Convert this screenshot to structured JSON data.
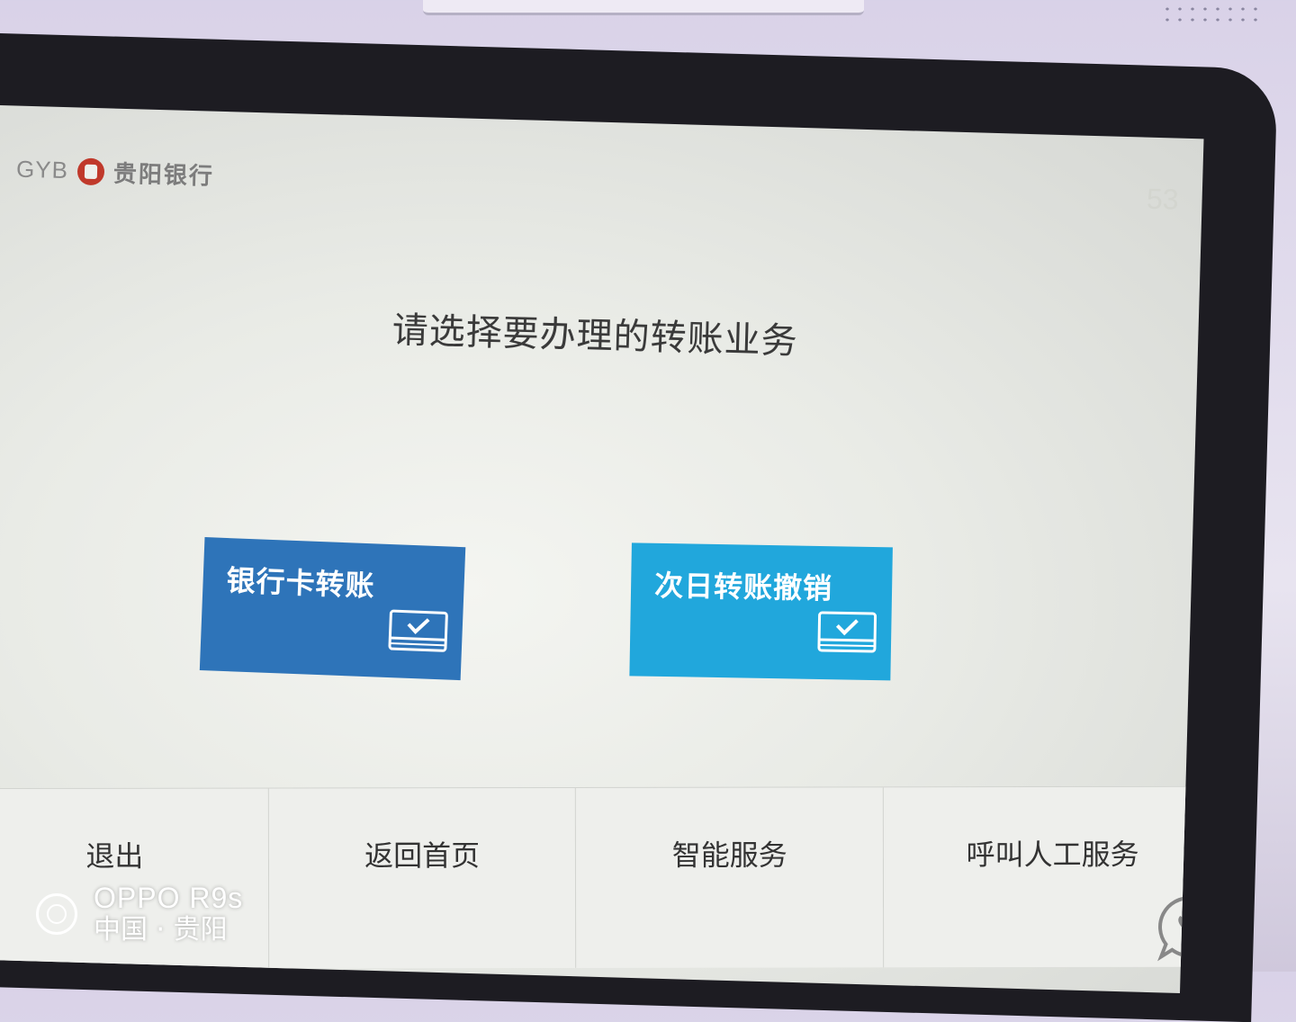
{
  "header": {
    "logo_en": "GYB",
    "logo_cn": "贵阳银行",
    "counter": "53"
  },
  "prompt": "请选择要办理的转账业务",
  "options": [
    {
      "label": "银行卡转账",
      "icon": "card-check-icon",
      "color": "#2e74b9"
    },
    {
      "label": "次日转账撤销",
      "icon": "card-check-icon",
      "color": "#21a7dc"
    }
  ],
  "bottom_nav": {
    "exit": "退出",
    "home": "返回首页",
    "smart": "智能服务",
    "call": "呼叫人工服务"
  },
  "watermark": {
    "device": "OPPO R9s",
    "location": "中国 · 贵阳"
  }
}
